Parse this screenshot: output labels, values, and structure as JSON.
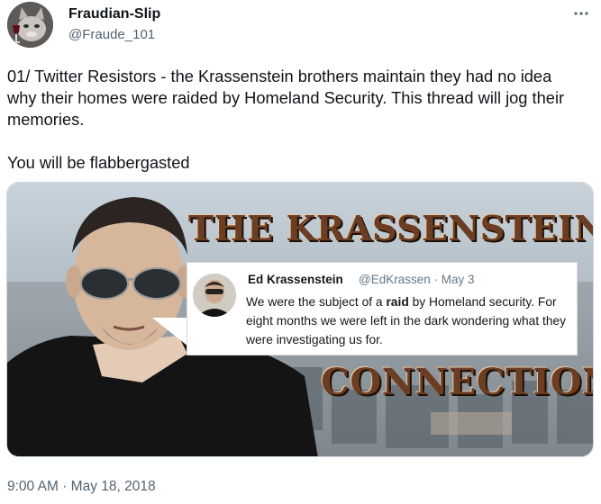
{
  "author": {
    "display_name": "Fraudian-Slip",
    "handle": "@Fraude_101",
    "avatar_icon": "cat-with-wine-icon"
  },
  "more_icon": "ellipsis-icon",
  "tweet": {
    "paragraph_1": "01/ Twitter Resistors - the Krassenstein brothers maintain they had no idea why their homes were raided by Homeland Security. This thread will jog their memories.",
    "paragraph_2": "You will be flabbergasted"
  },
  "media": {
    "banner_top": "THE KRASSENSTEIN",
    "banner_bottom": "CONNECTION",
    "embedded_tweet": {
      "name": "Ed Krassenstein",
      "handle": "@EdKrassen",
      "separator": "·",
      "date": "May 3",
      "text_before": "We were the subject of a ",
      "text_bold": "raid",
      "text_after": " by Homeland security. For eight months we were left in the dark wondering what they were investigating us for."
    }
  },
  "timestamp": {
    "time": "9:00 AM",
    "separator": "·",
    "date": "May 18, 2018"
  },
  "colors": {
    "text_primary": "#0f1419",
    "text_secondary": "#536471",
    "banner_brown": "#6b3e24"
  }
}
